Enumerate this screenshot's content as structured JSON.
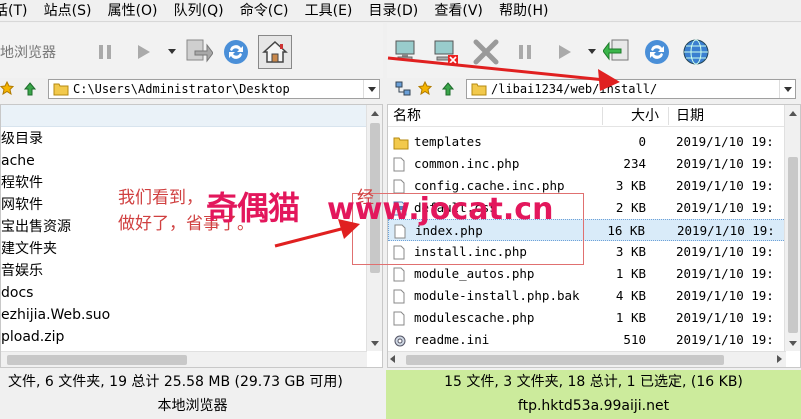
{
  "menu": [
    "话(T)",
    "站点(S)",
    "属性(O)",
    "队列(Q)",
    "命令(C)",
    "工具(E)",
    "目录(D)",
    "查看(V)",
    "帮助(H)"
  ],
  "left": {
    "toolbar_title": "本地浏览器",
    "path": "C:\\Users\\Administrator\\Desktop",
    "header": "上级目录",
    "rows": [
      "ache",
      "编程软件",
      "上网软件",
      "淘宝出售资源",
      "新建文件夹",
      "影音娱乐",
      "docs",
      "ezhijia.Web.suo",
      "pload.zip"
    ],
    "status": "文件, 6 文件夹, 19 总计 25.58 MB (29.73 GB 可用)",
    "footer": "本地浏览器"
  },
  "right": {
    "path": "/libai1234/web/install/",
    "columns": {
      "name": "名称",
      "size": "大小",
      "date": "日期"
    },
    "rows": [
      {
        "name": "templates",
        "size": "0",
        "date": "2019/1/10 19:",
        "type": "folder"
      },
      {
        "name": "common.inc.php",
        "size": "234",
        "date": "2019/1/10 19:",
        "type": "file"
      },
      {
        "name": "config.cache.inc.php",
        "size": "3 KB",
        "date": "2019/1/10 19:",
        "type": "file"
      },
      {
        "name": "default.css",
        "size": "2 KB",
        "date": "2019/1/10 19:",
        "type": "css"
      },
      {
        "name": "index.php",
        "size": "16 KB",
        "date": "2019/1/10 19:",
        "type": "file",
        "selected": true
      },
      {
        "name": "install.inc.php",
        "size": "3 KB",
        "date": "2019/1/10 19:",
        "type": "file"
      },
      {
        "name": "module_autos.php",
        "size": "1 KB",
        "date": "2019/1/10 19:",
        "type": "file"
      },
      {
        "name": "module-install.php.bak",
        "size": "4 KB",
        "date": "2019/1/10 19:",
        "type": "file"
      },
      {
        "name": "modulescache.php",
        "size": "1 KB",
        "date": "2019/1/10 19:",
        "type": "file"
      },
      {
        "name": "readme.ini",
        "size": "510",
        "date": "2019/1/10 19:",
        "type": "ini"
      }
    ],
    "status": "15 文件, 3 文件夹, 18 总计, 1 已选定, (16 KB)",
    "footer": "ftp.hktd53a.99aiji.net"
  },
  "annotation": {
    "line1": "我们看到，",
    "line1_tail": "经",
    "line2": "做好了，省事了。",
    "watermark_cn": "奇偶猫",
    "watermark_url": "www.jocat.cn"
  },
  "colors": {
    "status_right_bg": "#cceb9c",
    "selected_row": "#d9ebf9",
    "annotation_red": "#e02020",
    "watermark": "#e3175c"
  },
  "icons": {
    "pause": "pause-icon",
    "play": "play-icon",
    "transfer": "transfer-icon",
    "refresh": "refresh-icon",
    "home": "home-icon",
    "connect": "connect-icon",
    "disconnect": "disconnect-icon",
    "abort": "abort-x-icon",
    "globe": "globe-icon"
  }
}
